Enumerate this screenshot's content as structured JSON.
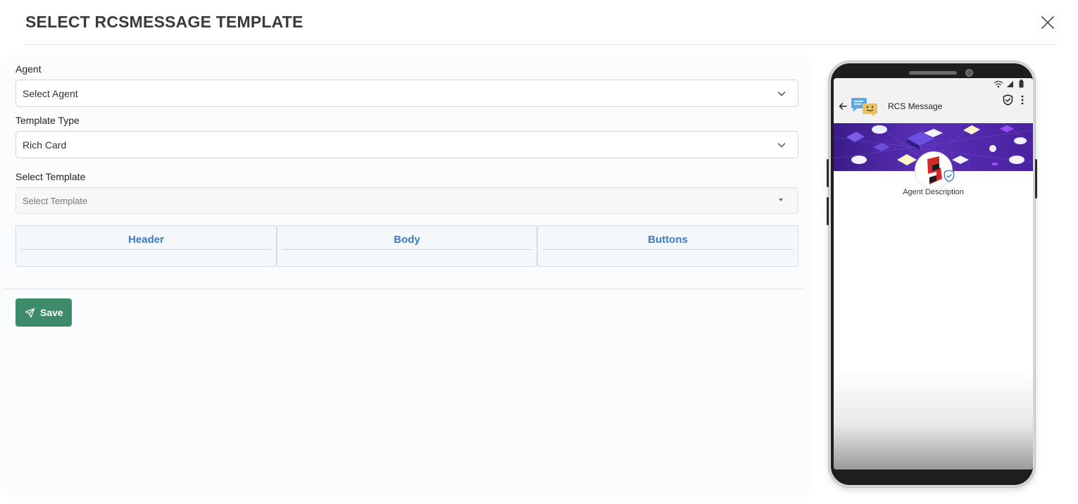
{
  "modal": {
    "title": "SELECT RCSMESSAGE TEMPLATE"
  },
  "form": {
    "agent_label": "Agent",
    "agent_value": "Select Agent",
    "template_type_label": "Template Type",
    "template_type_value": "Rich Card",
    "select_template_label": "Select Template",
    "select_template_placeholder": "Select Template",
    "tabs": [
      {
        "label": "Header"
      },
      {
        "label": "Body"
      },
      {
        "label": "Buttons"
      }
    ],
    "save_label": "Save"
  },
  "phone_preview": {
    "app_title": "RCS Message",
    "agent_description": "Agent Description"
  },
  "colors": {
    "accent_blue": "#3d7cc0",
    "save_green": "#3d8b6a",
    "banner_purple": "#4a22a0"
  },
  "icons": {
    "close": "close-icon",
    "chevron": "chevron-down-icon",
    "send": "send-icon",
    "back": "back-arrow-icon",
    "shield": "shield-check-icon",
    "more": "more-vertical-icon"
  }
}
